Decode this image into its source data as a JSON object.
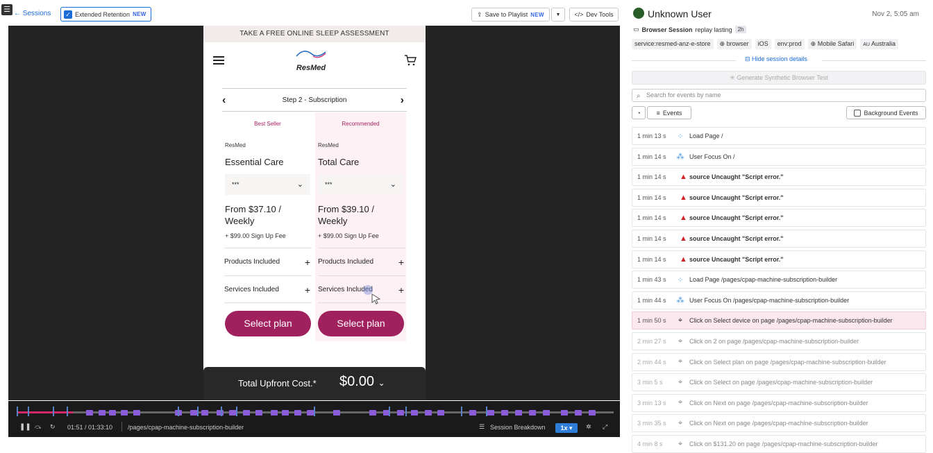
{
  "topbar": {
    "back_label": "Sessions",
    "retention_label": "Extended Retention",
    "retention_badge": "NEW",
    "save_label": "Save to Playlist",
    "save_badge": "NEW",
    "devtools_label": "Dev Tools"
  },
  "page": {
    "promo": "TAKE A FREE ONLINE SLEEP ASSESSMENT",
    "logo": "ResMed",
    "step": "Step 2 - Subscription",
    "plans": [
      {
        "tag": "Best Seller",
        "brand": "ResMed",
        "name": "Essential Care",
        "select_value": "***",
        "price": "From $37.10 / Weekly",
        "fee": "+ $99.00 Sign Up Fee",
        "products": "Products Included",
        "services": "Services Included",
        "cta": "Select plan"
      },
      {
        "tag": "Recommended",
        "brand": "ResMed",
        "name": "Total Care",
        "select_value": "***",
        "price": "From $39.10 / Weekly",
        "fee": "+ $99.00 Sign Up Fee",
        "products": "Products Included",
        "services": "Services Included",
        "cta": "Select plan"
      }
    ],
    "total_label": "Total Upfront Cost.*",
    "total_value": "$0.00"
  },
  "player": {
    "progress": 0.094,
    "time": "01:51 / 01:33:10",
    "path": "/pages/cpap-machine-subscription-builder",
    "breakdown_label": "Session Breakdown",
    "speed": "1x"
  },
  "session": {
    "user": "Unknown User",
    "date": "Nov 2, 5:05 am",
    "type": "Browser Session",
    "replay_text": "replay lasting",
    "duration": "2h",
    "tags": [
      "service:resmed-anz-e-store",
      "browser",
      "iOS",
      "env:prod",
      "Mobile Safari",
      "Australia"
    ],
    "country_code": "AU",
    "hide_details": "Hide session details",
    "synthetic_label": "Generate Synthetic Browser Test",
    "search_placeholder": "Search for events by name",
    "events_label": "Events",
    "background_label": "Background Events",
    "events": [
      {
        "time": "1 min 13 s",
        "kind": "load",
        "text": "Load Page /"
      },
      {
        "time": "1 min 14 s",
        "kind": "focus",
        "text": "User Focus On /"
      },
      {
        "time": "1 min 14 s",
        "kind": "error",
        "text": "source Uncaught \"Script error.\""
      },
      {
        "time": "1 min 14 s",
        "kind": "error",
        "text": "source Uncaught \"Script error.\""
      },
      {
        "time": "1 min 14 s",
        "kind": "error",
        "text": "source Uncaught \"Script error.\""
      },
      {
        "time": "1 min 14 s",
        "kind": "error",
        "text": "source Uncaught \"Script error.\""
      },
      {
        "time": "1 min 14 s",
        "kind": "error",
        "text": "source Uncaught \"Script error.\""
      },
      {
        "time": "1 min 43 s",
        "kind": "load",
        "text": "Load Page /pages/cpap-machine-subscription-builder"
      },
      {
        "time": "1 min 44 s",
        "kind": "focus",
        "text": "User Focus On /pages/cpap-machine-subscription-builder"
      },
      {
        "time": "1 min 50 s",
        "kind": "click",
        "text": "Click on Select device on page /pages/cpap-machine-subscription-builder",
        "state": "highlight"
      },
      {
        "time": "2 min 27 s",
        "kind": "click",
        "text": "Click on 2 on page /pages/cpap-machine-subscription-builder",
        "state": "faded"
      },
      {
        "time": "2 min 44 s",
        "kind": "click",
        "text": "Click on Select plan on page /pages/cpap-machine-subscription-builder",
        "state": "faded"
      },
      {
        "time": "3 min 5 s",
        "kind": "click",
        "text": "Click on Select on page /pages/cpap-machine-subscription-builder",
        "state": "faded"
      },
      {
        "time": "3 min 13 s",
        "kind": "click",
        "text": "Click on Next on page /pages/cpap-machine-subscription-builder",
        "state": "faded"
      },
      {
        "time": "3 min 35 s",
        "kind": "click",
        "text": "Click on Next on page /pages/cpap-machine-subscription-builder",
        "state": "faded"
      },
      {
        "time": "4 min 8 s",
        "kind": "click",
        "text": "Click on $131.20 on page /pages/cpap-machine-subscription-builder",
        "state": "faded"
      }
    ]
  }
}
